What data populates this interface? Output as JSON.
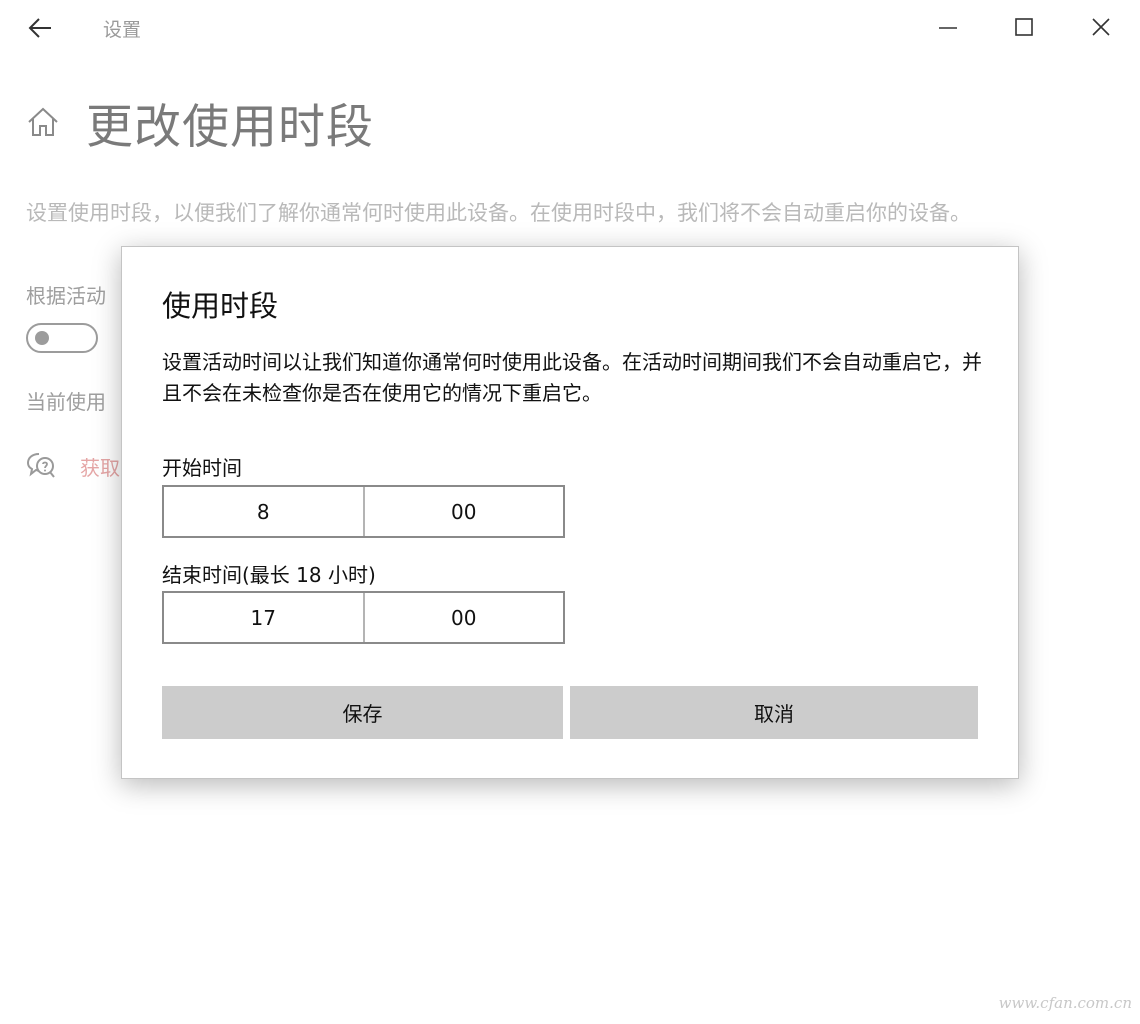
{
  "titlebar": {
    "app_title": "设置",
    "icons": {
      "back": "back-arrow-icon",
      "minimize": "minimize-icon",
      "maximize": "maximize-icon",
      "close": "close-icon"
    }
  },
  "page": {
    "home_icon": "home-icon",
    "title": "更改使用时段",
    "description": "设置使用时段，以便我们了解你通常何时使用此设备。在使用时段中，我们将不会自动重启你的设备。",
    "auto_adjust_label": "根据活动",
    "current_label": "当前使用",
    "help_link": "获取",
    "help_icon": "help-chat-icon"
  },
  "dialog": {
    "title": "使用时段",
    "description": "设置活动时间以让我们知道你通常何时使用此设备。在活动时间期间我们不会自动重启它，并且不会在未检查你是否在使用它的情况下重启它。",
    "start": {
      "label": "开始时间",
      "hour": "8",
      "minute": "00"
    },
    "end": {
      "label": "结束时间(最长 18 小时)",
      "hour": "17",
      "minute": "00"
    },
    "save_label": "保存",
    "cancel_label": "取消"
  },
  "watermark": "www.cfan.com.cn",
  "colors": {
    "button_bg": "#cccccc",
    "help_link": "#e5a6a6",
    "dim_text": "#b9b9b9"
  }
}
